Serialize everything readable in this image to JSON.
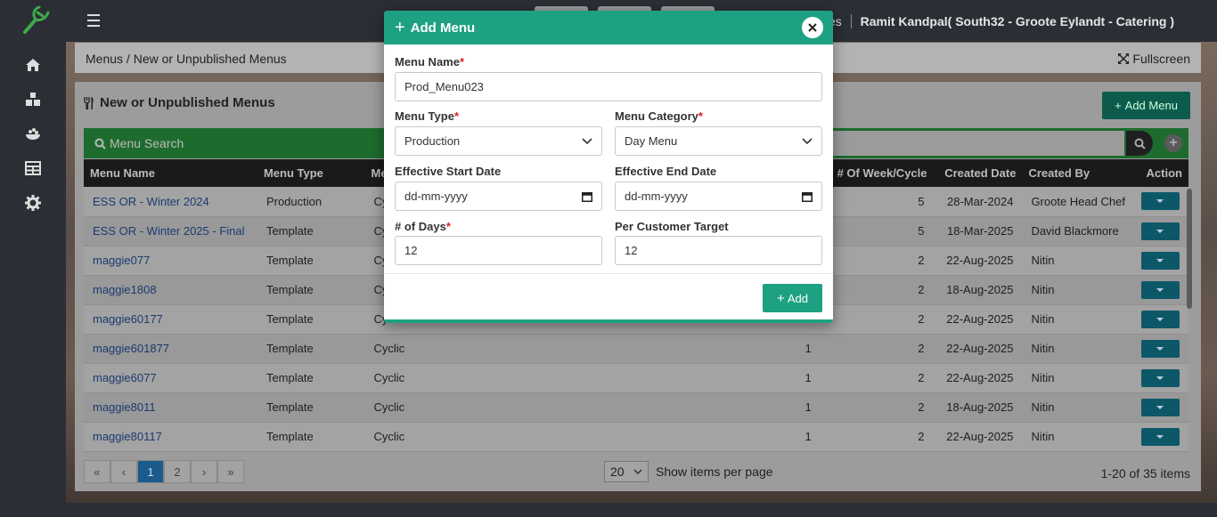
{
  "topbar": {
    "resources": "esources",
    "user": "Ramit Kandpal( South32 - Groote Eylandt - Catering )"
  },
  "breadcrumb": {
    "root": "Menus",
    "sep": "/",
    "current": "New or Unpublished Menus",
    "fullscreen": "Fullscreen"
  },
  "panel": {
    "title": "New or Unpublished Menus",
    "add_menu": "Add Menu",
    "search_placeholder": "Menu Search"
  },
  "table": {
    "headers": [
      "Menu Name",
      "Menu Type",
      "Me",
      "# Of Week/Cycle",
      "Created Date",
      "Created By",
      "Action"
    ],
    "rows": [
      {
        "name": "ESS OR - Winter 2024",
        "type": "Production",
        "cyc": "Cyc",
        "d": "",
        "wk": "5",
        "date": "28-Mar-2024",
        "by": "Groote Head Chef"
      },
      {
        "name": "ESS OR - Winter 2025 - Final",
        "type": "Template",
        "cyc": "Cy",
        "d": "",
        "wk": "5",
        "date": "18-Mar-2025",
        "by": "David Blackmore"
      },
      {
        "name": "maggie077",
        "type": "Template",
        "cyc": "Cy",
        "d": "",
        "wk": "2",
        "date": "22-Aug-2025",
        "by": "Nitin"
      },
      {
        "name": "maggie1808",
        "type": "Template",
        "cyc": "Cy",
        "d": "",
        "wk": "2",
        "date": "18-Aug-2025",
        "by": "Nitin"
      },
      {
        "name": "maggie60177",
        "type": "Template",
        "cyc": "Cy",
        "d": "",
        "wk": "2",
        "date": "22-Aug-2025",
        "by": "Nitin"
      },
      {
        "name": "maggie601877",
        "type": "Template",
        "cyc": "Cyclic",
        "d": "1",
        "wk": "2",
        "date": "22-Aug-2025",
        "by": "Nitin"
      },
      {
        "name": "maggie6077",
        "type": "Template",
        "cyc": "Cyclic",
        "d": "1",
        "wk": "2",
        "date": "22-Aug-2025",
        "by": "Nitin"
      },
      {
        "name": "maggie8011",
        "type": "Template",
        "cyc": "Cyclic",
        "d": "1",
        "wk": "2",
        "date": "18-Aug-2025",
        "by": "Nitin"
      },
      {
        "name": "maggie80117",
        "type": "Template",
        "cyc": "Cyclic",
        "d": "1",
        "wk": "2",
        "date": "22-Aug-2025",
        "by": "Nitin"
      }
    ]
  },
  "pager": {
    "first": "«",
    "prev": "‹",
    "p1": "1",
    "p2": "2",
    "next": "›",
    "last": "»"
  },
  "per_page": {
    "value": "20",
    "label": "Show items per page"
  },
  "items_count": "1-20 of 35 items",
  "modal": {
    "title": "Add Menu",
    "menu_name_label": "Menu Name",
    "menu_name_value": "Prod_Menu023",
    "menu_type_label": "Menu Type",
    "menu_type_value": "Production",
    "menu_category_label": "Menu Category",
    "menu_category_value": "Day Menu",
    "start_label": "Effective Start Date",
    "start_value": "dd-mm-yyyy",
    "end_label": "Effective End Date",
    "end_value": "dd-mm-yyyy",
    "days_label": "# of Days",
    "days_value": "12",
    "target_label": "Per Customer Target",
    "target_value": "12",
    "add_label": "Add",
    "required_mark": "*"
  },
  "colors": {
    "accent": "#1ea182",
    "sidebar": "#2b2f35",
    "link": "#1a3b70"
  }
}
